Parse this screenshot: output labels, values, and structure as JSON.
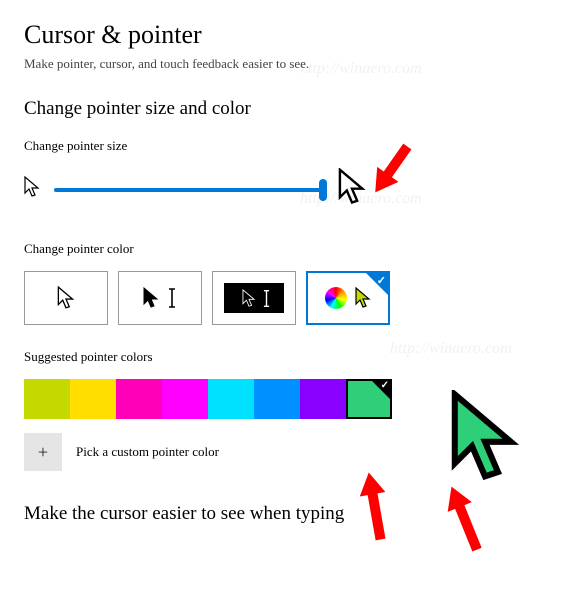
{
  "page": {
    "title": "Cursor & pointer",
    "subtitle": "Make pointer, cursor, and touch feedback easier to see."
  },
  "section_size_color": {
    "heading": "Change pointer size and color",
    "size_label": "Change pointer size",
    "color_label": "Change pointer color"
  },
  "pointer_color_options": [
    {
      "id": "white",
      "selected": false
    },
    {
      "id": "black",
      "selected": false
    },
    {
      "id": "inverted",
      "selected": false
    },
    {
      "id": "custom",
      "selected": true
    }
  ],
  "suggested": {
    "label": "Suggested pointer colors",
    "colors": [
      {
        "hex": "#c3d900",
        "selected": false
      },
      {
        "hex": "#ffde00",
        "selected": false
      },
      {
        "hex": "#ff00b8",
        "selected": false
      },
      {
        "hex": "#ff00ff",
        "selected": false
      },
      {
        "hex": "#00e0ff",
        "selected": false
      },
      {
        "hex": "#0090ff",
        "selected": false
      },
      {
        "hex": "#8a00ff",
        "selected": false
      },
      {
        "hex": "#2fcf7a",
        "selected": true
      }
    ]
  },
  "custom_button": {
    "plus": "+",
    "label": "Pick a custom pointer color"
  },
  "section_typing": {
    "heading": "Make the cursor easier to see when typing"
  },
  "watermark": {
    "text1": "http://winaero.com",
    "text2": "http://winaero.com"
  }
}
